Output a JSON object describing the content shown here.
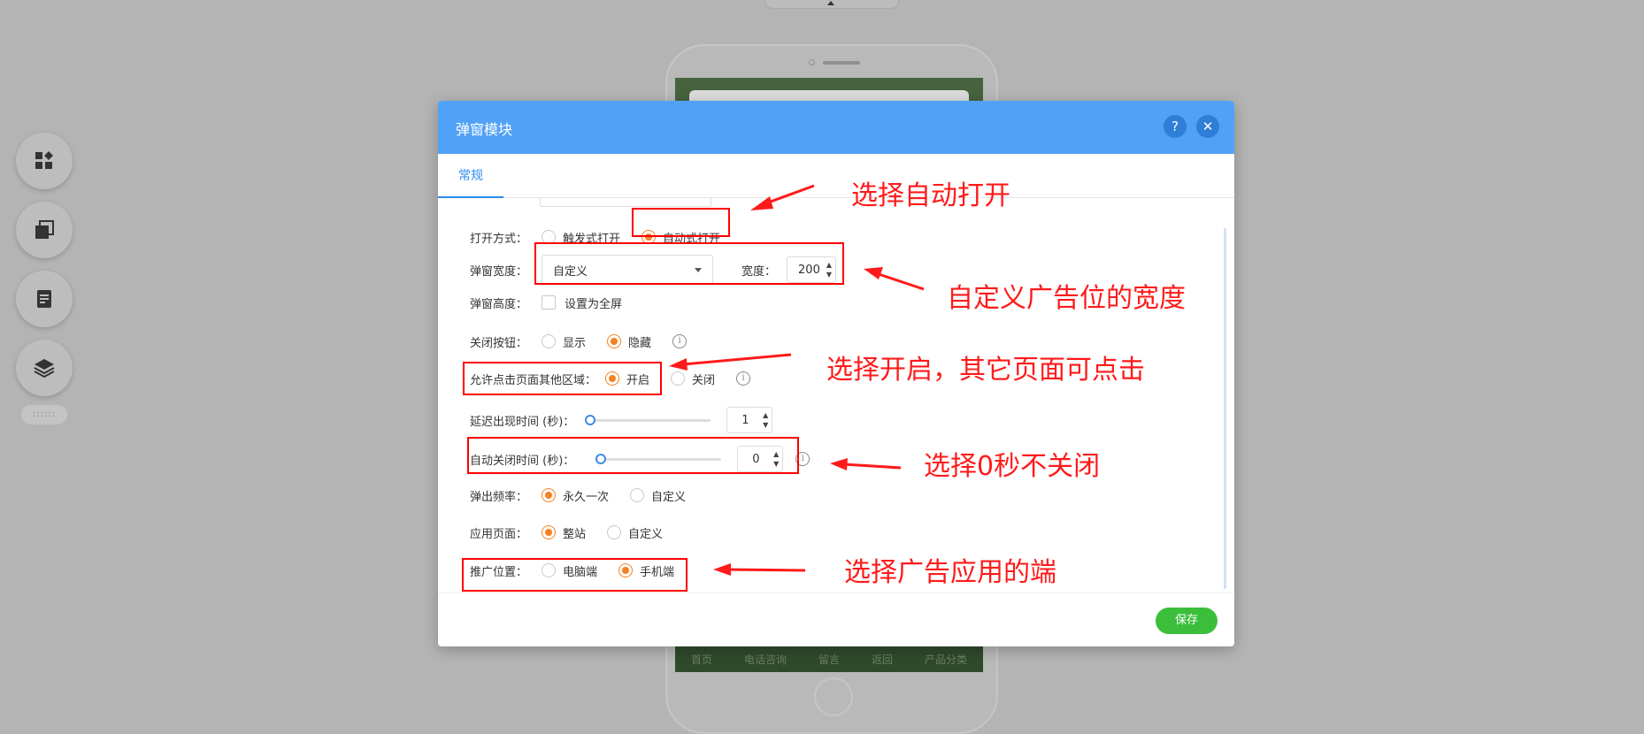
{
  "background": {
    "toolbar_icons": [
      "widgets-icon",
      "copy-icon",
      "document-icon",
      "layers-icon"
    ],
    "handle_label": "::::::",
    "phone_nav": [
      "首页",
      "电话咨询",
      "留言",
      "返回",
      "产品分类"
    ]
  },
  "dialog": {
    "title": "弹窗模块",
    "help_label": "?",
    "close_label": "✕",
    "tab_general": "常规",
    "open_mode": {
      "label": "打开方式：",
      "options": [
        "触发式打开",
        "自动式打开"
      ],
      "selected": "自动式打开"
    },
    "popup_width": {
      "label": "弹窗宽度：",
      "select_value": "自定义",
      "width_label": "宽度：",
      "width_value": "200"
    },
    "popup_height": {
      "label": "弹窗高度：",
      "checkbox_label": "设置为全屏"
    },
    "close_button": {
      "label": "关闭按钮：",
      "options": [
        "显示",
        "隐藏"
      ],
      "selected": "隐藏"
    },
    "allow_click": {
      "label": "允许点击页面其他区域：",
      "options": [
        "开启",
        "关闭"
      ],
      "selected": "开启"
    },
    "delay_time": {
      "label": "延迟出现时间 (秒)：",
      "value": "1",
      "slider_fraction": 0.0
    },
    "auto_close": {
      "label": "自动关闭时间 (秒)：",
      "value": "0",
      "slider_fraction": 0.0
    },
    "frequency": {
      "label": "弹出频率：",
      "options": [
        "永久一次",
        "自定义"
      ],
      "selected": "永久一次"
    },
    "apply_page": {
      "label": "应用页面：",
      "options": [
        "整站",
        "自定义"
      ],
      "selected": "整站"
    },
    "promo_position": {
      "label": "推广位置：",
      "options": [
        "电脑端",
        "手机端"
      ],
      "selected": "手机端"
    },
    "save_label": "保存"
  },
  "annotations": {
    "auto_open": "选择自动打开",
    "custom_width": "自定义广告位的宽度",
    "enable_click": "选择开启，其它页面可点击",
    "zero_seconds": "选择0秒不关闭",
    "platform": "选择广告应用的端"
  },
  "colors": {
    "header": "#51a1f6",
    "accent": "#2d8cf0",
    "radio_on": "#f58220",
    "save": "#3bbf3b",
    "annotation": "#ff0000"
  }
}
